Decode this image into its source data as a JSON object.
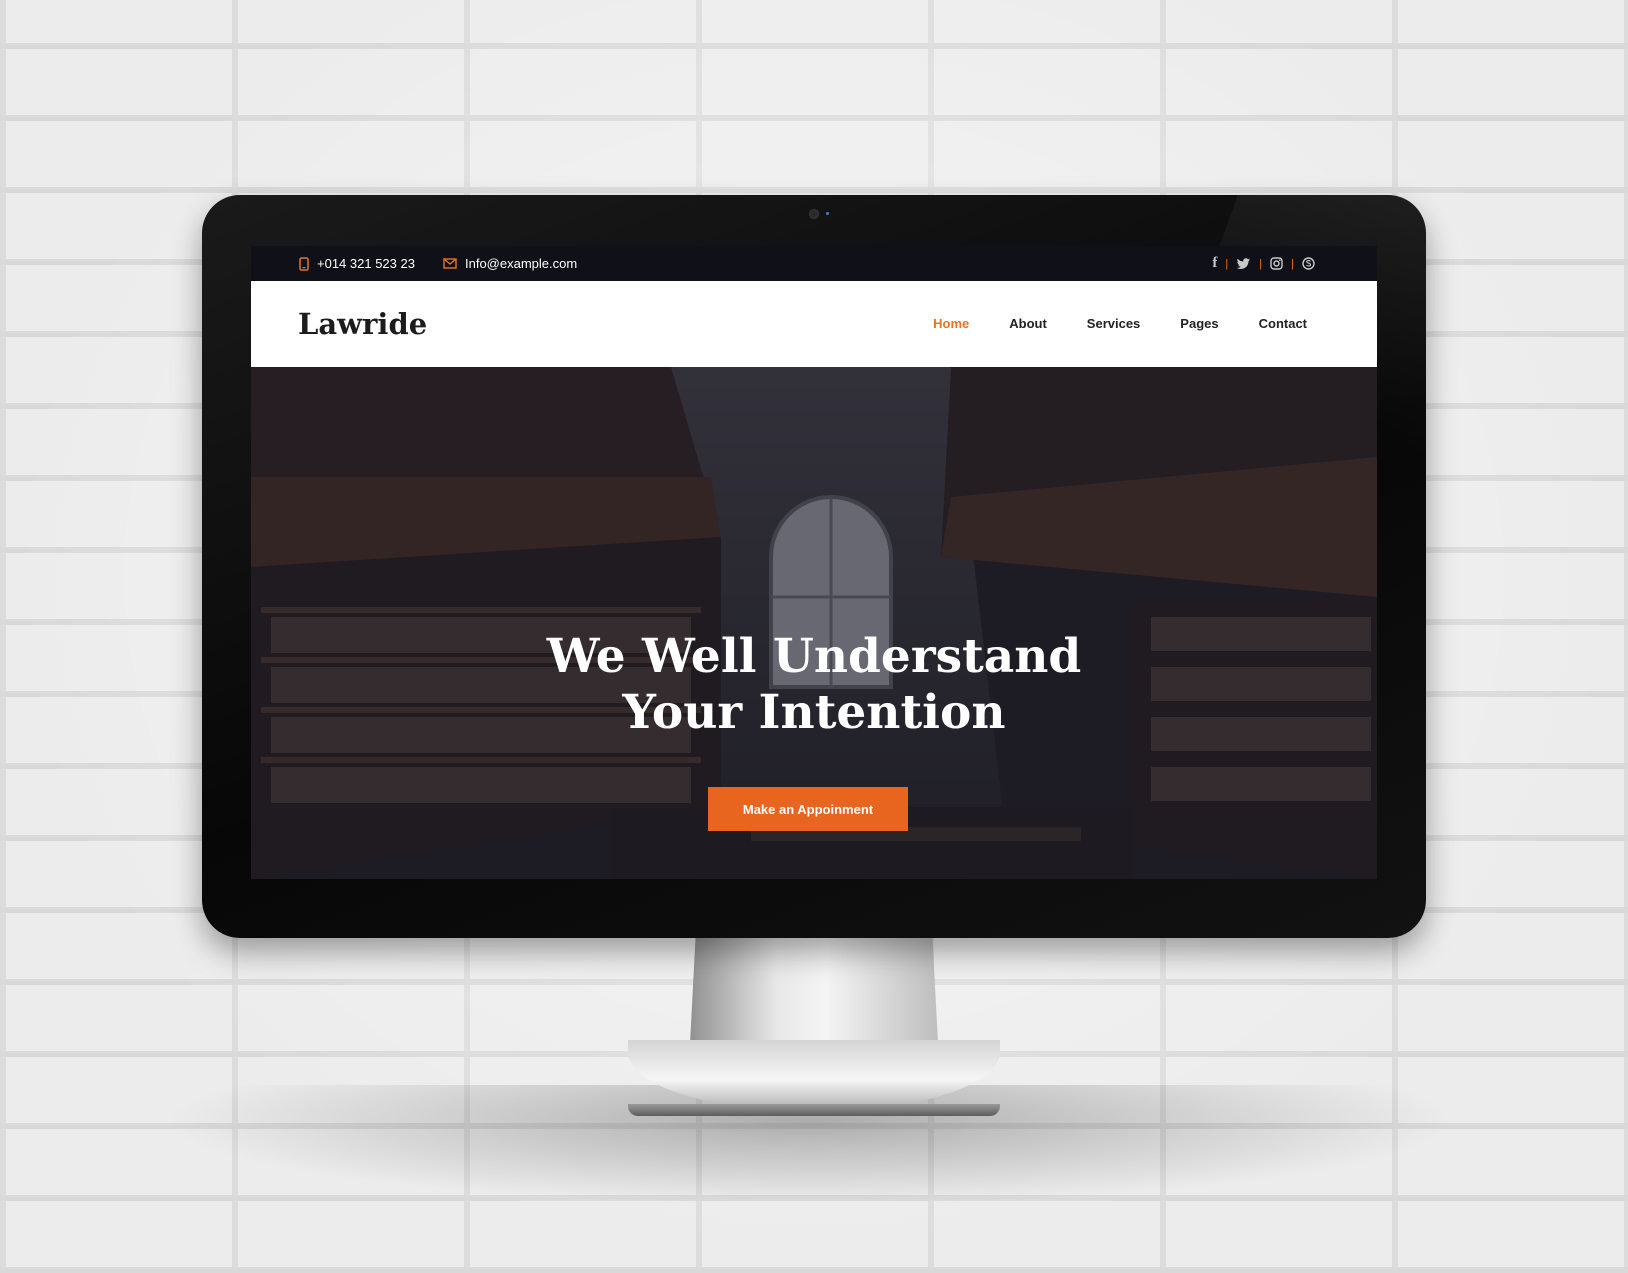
{
  "topbar": {
    "phone_icon": "phone-icon",
    "phone": "+014 321 523 23",
    "email_icon": "envelope-icon",
    "email": "Info@example.com",
    "socials": [
      "facebook-icon",
      "twitter-icon",
      "instagram-icon",
      "skype-icon"
    ],
    "social_separator": "|"
  },
  "navbar": {
    "logo": "Lawride",
    "items": [
      {
        "label": "Home",
        "active": true
      },
      {
        "label": "About",
        "active": false
      },
      {
        "label": "Services",
        "active": false
      },
      {
        "label": "Pages",
        "active": false
      },
      {
        "label": "Contact",
        "active": false
      }
    ]
  },
  "hero": {
    "title_line1": "We Well Understand",
    "title_line2": "Your Intention",
    "button_label": "Make an Appoinment",
    "background": "library-bookshelves-image"
  },
  "colors": {
    "accent": "#e8741f",
    "button": "#e8651f",
    "topbar_bg": "#0f1018",
    "navbar_bg": "#ffffff"
  }
}
